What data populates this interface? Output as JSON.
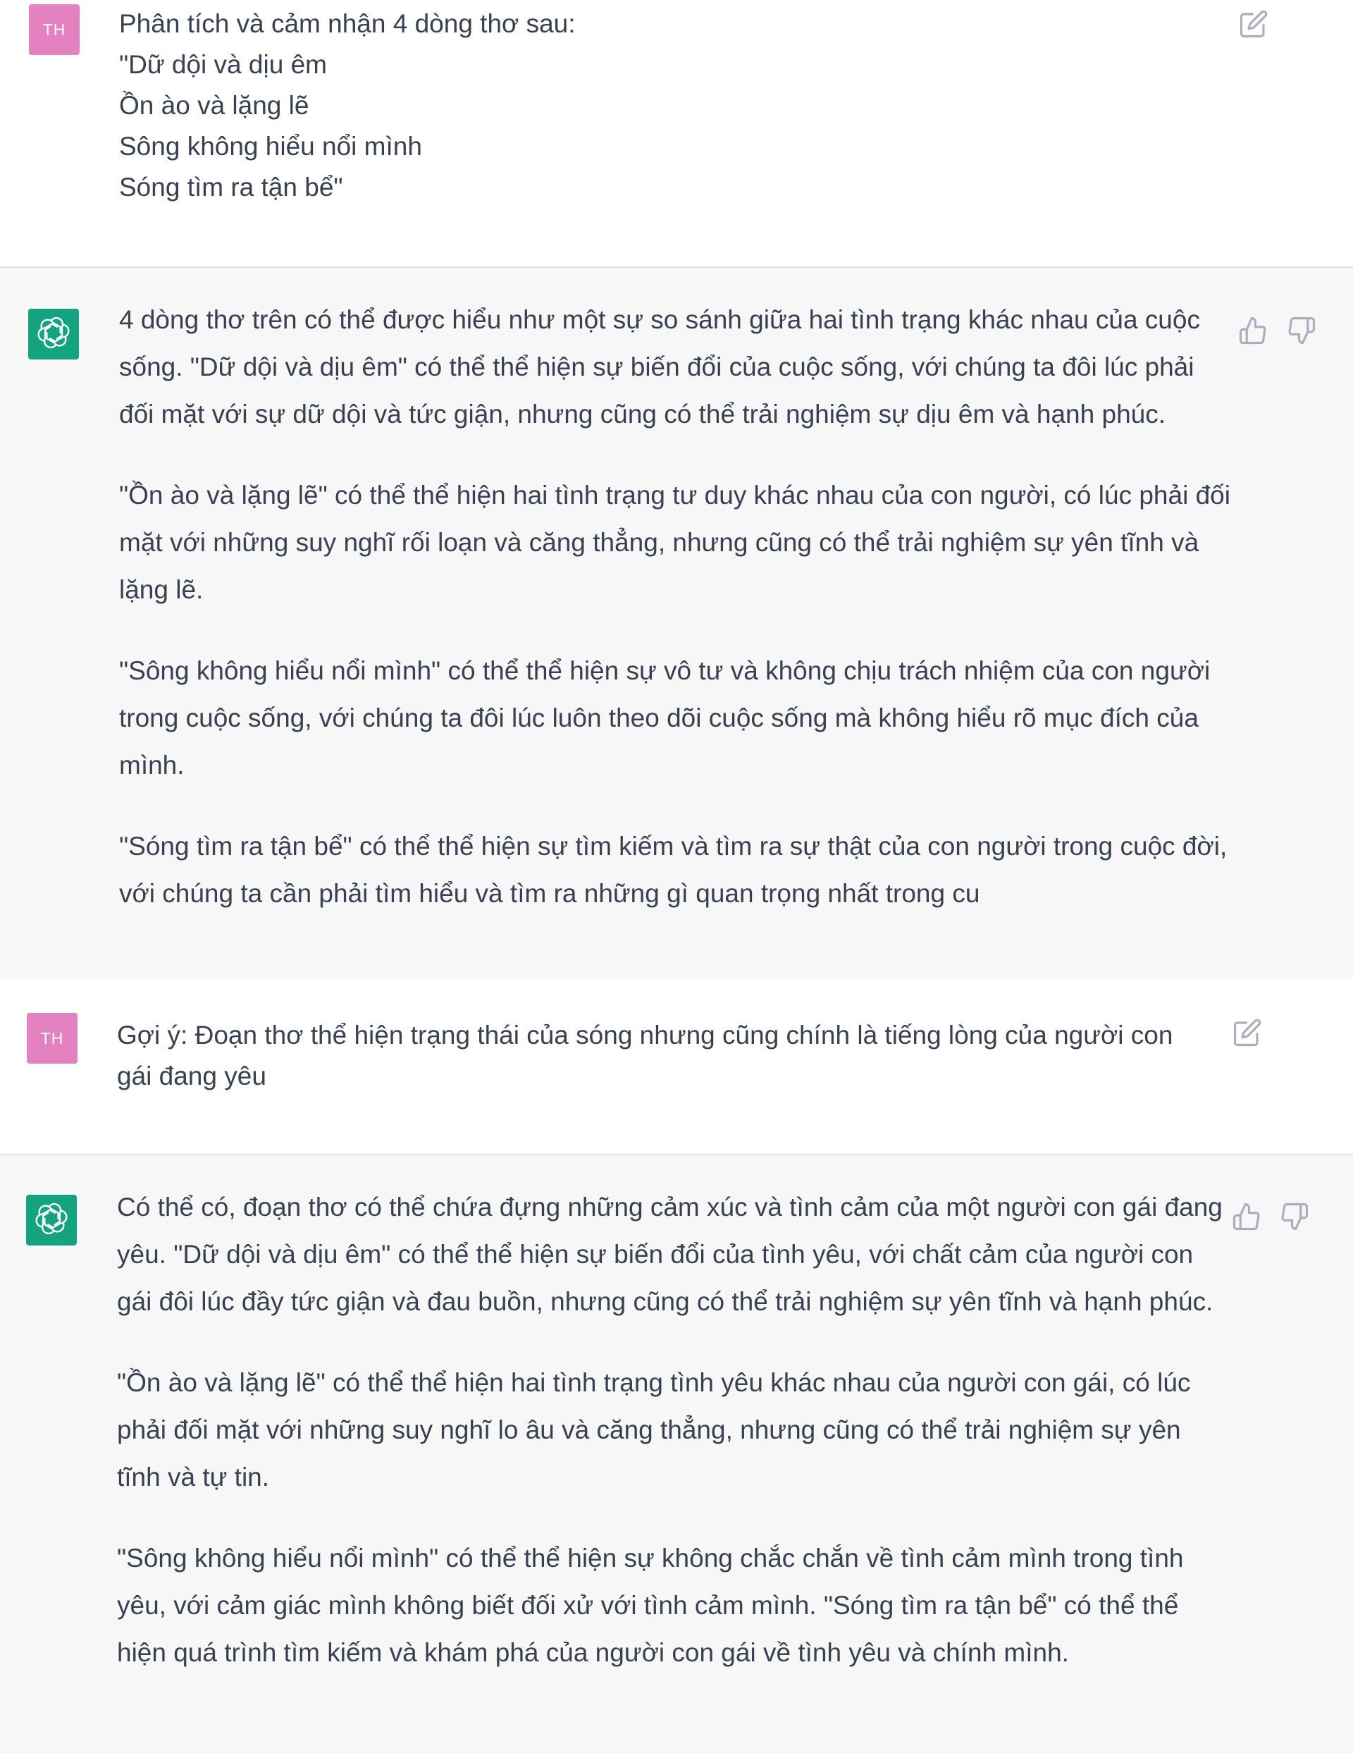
{
  "messages": [
    {
      "role": "user",
      "avatar_initials": "TH",
      "text_lines": [
        "Phân tích và cảm nhận 4 dòng thơ sau:",
        "\"Dữ dội và dịu êm",
        "Ồn ào và lặng lẽ",
        "Sông không hiểu nổi mình",
        "Sóng tìm ra tận bể\""
      ],
      "action_icons": [
        "edit-icon"
      ]
    },
    {
      "role": "assistant",
      "avatar_icon": "openai-logo-icon",
      "paragraphs": [
        "4 dòng thơ trên có thể được hiểu như một sự so sánh giữa hai tình trạng khác nhau của cuộc sống. \"Dữ dội và dịu êm\" có thể thể hiện sự biến đổi của cuộc sống, với chúng ta đôi lúc phải đối mặt với sự dữ dội và tức giận, nhưng cũng có thể trải nghiệm sự dịu êm và hạnh phúc.",
        "\"Ồn ào và lặng lẽ\" có thể thể hiện hai tình trạng tư duy khác nhau của con người, có lúc phải đối mặt với những suy nghĩ rối loạn và căng thẳng, nhưng cũng có thể trải nghiệm sự yên tĩnh và lặng lẽ.",
        "\"Sông không hiểu nổi mình\" có thể thể hiện sự vô tư và không chịu trách nhiệm của con người trong cuộc sống, với chúng ta đôi lúc luôn theo dõi cuộc sống mà không hiểu rõ mục đích của mình.",
        "\"Sóng tìm ra tận bể\" có thể thể hiện sự tìm kiếm và tìm ra sự thật của con người trong cuộc đời, với chúng ta cần phải tìm hiểu và tìm ra những gì quan trọng nhất trong cu"
      ],
      "action_icons": [
        "thumbs-up-icon",
        "thumbs-down-icon"
      ]
    },
    {
      "role": "user",
      "avatar_initials": "TH",
      "text_lines": [
        "Gợi ý: Đoạn thơ thể hiện trạng thái của sóng nhưng cũng chính là tiếng lòng của người con",
        "gái đang yêu"
      ],
      "action_icons": [
        "edit-icon"
      ]
    },
    {
      "role": "assistant",
      "avatar_icon": "openai-logo-icon",
      "paragraphs": [
        "Có thể có, đoạn thơ có thể chứa đựng những cảm xúc và tình cảm của một người con gái đang yêu. \"Dữ dội và dịu êm\" có thể thể hiện sự biến đổi của tình yêu, với chất cảm của người con gái đôi lúc đầy tức giận và đau buồn, nhưng cũng có thể trải nghiệm sự yên tĩnh và hạnh phúc.",
        "\"Ồn ào và lặng lẽ\" có thể thể hiện hai tình trạng tình yêu khác nhau của người con gái, có lúc phải đối mặt với những suy nghĩ lo âu và căng thẳng, nhưng cũng có thể trải nghiệm sự yên tĩnh và tự tin.",
        "\"Sông không hiểu nổi mình\" có thể thể hiện sự không chắc chắn về tình cảm mình trong tình yêu, với cảm giác mình không biết đối xử với tình cảm mình. \"Sóng tìm ra tận bể\" có thể thể hiện quá trình tìm kiếm và khám phá của người con gái về tình yêu và chính mình."
      ],
      "action_icons": [
        "thumbs-up-icon",
        "thumbs-down-icon"
      ]
    }
  ],
  "colors": {
    "user_background": "#ffffff",
    "assistant_background": "#f7f7f8",
    "user_avatar": "#e481c0",
    "assistant_avatar": "#13a37f",
    "text": "#374151",
    "icon": "#acacbe"
  }
}
